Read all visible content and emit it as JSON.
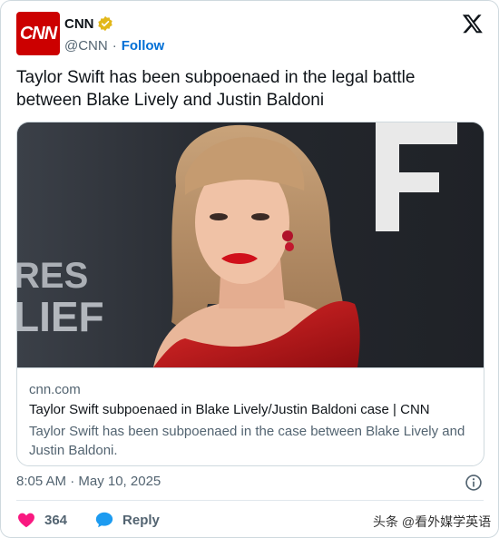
{
  "author": {
    "avatar_text": "CNN",
    "display_name": "CNN",
    "handle": "@CNN",
    "separator": "·",
    "follow_label": "Follow"
  },
  "tweet": {
    "text": "Taylor Swift has been subpoenaed in the legal battle between Blake Lively and Justin Baldoni"
  },
  "link_card": {
    "domain": "cnn.com",
    "title": "Taylor Swift subpoenaed in Blake Lively/Justin Baldoni case | CNN",
    "description": "Taylor Swift has been subpoenaed in the case between Blake Lively and Justin Baldoni.",
    "image_bg_text_1": "RES",
    "image_bg_text_2": "LIEF",
    "image_bg_letter": "F"
  },
  "meta": {
    "timestamp": "8:05 AM · May 10, 2025"
  },
  "actions": {
    "like_count": "364",
    "reply_label": "Reply"
  },
  "watermark": "头条 @看外媒学英语",
  "icons": {
    "verified": "verified-badge-icon",
    "x_logo": "x-logo-icon",
    "info": "info-icon",
    "like": "heart-icon",
    "reply": "speech-bubble-icon"
  },
  "colors": {
    "brand": "#cc0000",
    "link": "#006fd6",
    "like": "#f91880",
    "reply": "#1d9bf0",
    "verified": "#e2b719"
  }
}
